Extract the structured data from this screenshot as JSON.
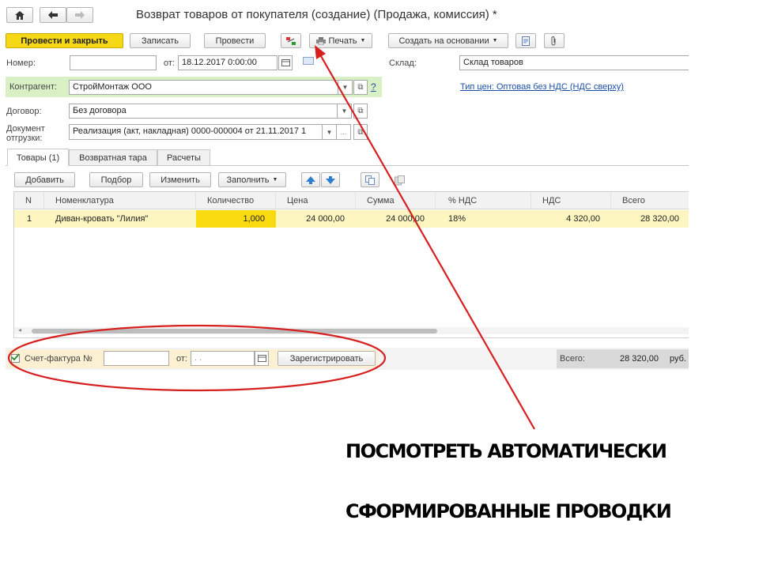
{
  "window": {
    "title": "Возврат товаров от покупателя (создание) (Продажа, комиссия) *"
  },
  "nav": {
    "home_icon": "home-icon",
    "back_icon": "arrow-left-icon",
    "forward_icon": "arrow-right-icon"
  },
  "toolbar": {
    "post_close": "Провести и закрыть",
    "save": "Записать",
    "post": "Провести",
    "print": "Печать",
    "create_based": "Создать на основании"
  },
  "header": {
    "number_label": "Номер:",
    "number_value": "",
    "date_label": "от:",
    "date_value": "18.12.2017  0:00:00",
    "warehouse_label": "Склад:",
    "warehouse_value": "Склад товаров",
    "counterparty_label": "Контрагент:",
    "counterparty_value": "СтройМонтаж ООО",
    "help_mark": "?",
    "price_type_link": "Тип цен: Оптовая без НДС (НДС сверху)",
    "contract_label": "Договор:",
    "contract_value": "Без договора",
    "shipment_label_1": "Документ",
    "shipment_label_2": "отгрузки:",
    "shipment_value": "Реализация (акт, накладная) 0000-000004 от 21.11.2017 1"
  },
  "tabs": [
    {
      "label": "Товары (1)"
    },
    {
      "label": "Возвратная тара"
    },
    {
      "label": "Расчеты"
    }
  ],
  "table_toolbar": {
    "add": "Добавить",
    "select": "Подбор",
    "edit": "Изменить",
    "fill": "Заполнить"
  },
  "table": {
    "columns": [
      "N",
      "Номенклатура",
      "Количество",
      "Цена",
      "Сумма",
      "% НДС",
      "НДС",
      "Всего"
    ],
    "rows": [
      {
        "n": "1",
        "item": "Диван-кровать \"Лилия\"",
        "qty": "1,000",
        "price": "24 000,00",
        "sum": "24 000,00",
        "vat_rate": "18%",
        "vat": "4 320,00",
        "total": "28 320,00"
      }
    ]
  },
  "footer": {
    "invoice_label": "Счет-фактура №",
    "invoice_number": "",
    "invoice_date_label": "от:",
    "invoice_date_value": " .  .",
    "register_button": "Зарегистрировать",
    "total_label": "Всего:",
    "total_value": "28 320,00",
    "currency": "руб."
  },
  "annotation": {
    "line1": "ПОСМОТРЕТЬ АВТОМАТИЧЕСКИ",
    "line2": "СФОРМИРОВАННЫЕ ПРОВОДКИ",
    "color": "#d6201f"
  },
  "colors": {
    "accent_yellow": "#f6d816",
    "green_bar": "#d9efc4",
    "row_highlight": "#fdf6c0",
    "qty_cell": "#f9d90f"
  }
}
